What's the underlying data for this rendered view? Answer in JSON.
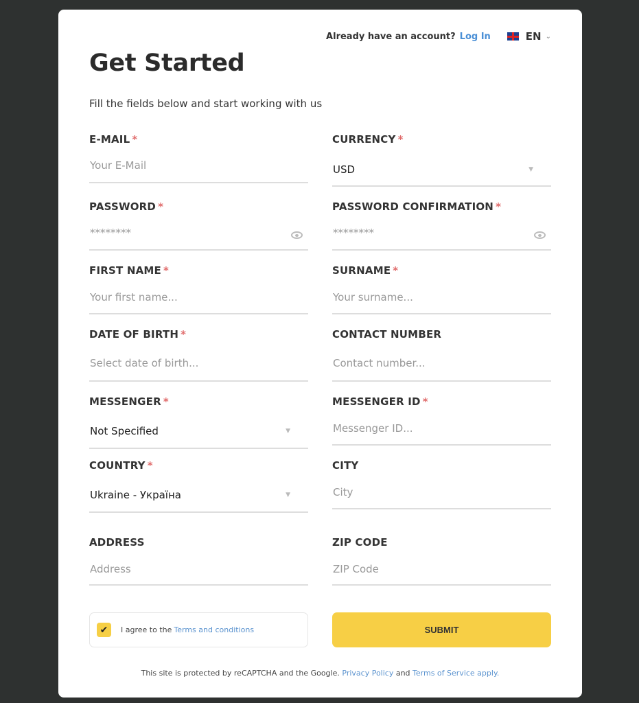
{
  "header": {
    "already": "Already have an account?",
    "login": "Log In",
    "language": "EN",
    "flag_icon": "uk-flag-icon"
  },
  "title": "Get Started",
  "subtitle": "Fill the fields below and start working with us",
  "fields": [
    {
      "label": "E-mail",
      "required": true,
      "placeholder": "Your E-Mail"
    },
    {
      "label": "Currency",
      "required": true,
      "value": "USD"
    },
    {
      "label": "Password",
      "required": true,
      "placeholder": "********"
    },
    {
      "label": "Password Confirmation",
      "required": true,
      "placeholder": "********"
    },
    {
      "label": "First Name",
      "required": true,
      "placeholder": "Your first name..."
    },
    {
      "label": "Surname",
      "required": true,
      "placeholder": "Your surname..."
    },
    {
      "label": "Date of Birth",
      "required": true,
      "placeholder": "Select date of birth..."
    },
    {
      "label": "Contact Number",
      "required": false,
      "placeholder": "Contact number..."
    },
    {
      "label": "Messenger",
      "required": true,
      "value": "Not Specified"
    },
    {
      "label": "Messenger ID",
      "required": true,
      "placeholder": "Messenger ID..."
    },
    {
      "label": "Country",
      "required": true,
      "value": "Ukraine - Україна"
    },
    {
      "label": "City",
      "required": false,
      "placeholder": "City"
    },
    {
      "label": "Address",
      "required": false,
      "placeholder": "Address"
    },
    {
      "label": "ZIP Code",
      "required": false,
      "placeholder": "ZIP Code"
    }
  ],
  "required_mark": "*",
  "agree": {
    "checked": true,
    "text": "I agree to the",
    "link": "Terms and conditions"
  },
  "submit": "SUBMIT",
  "footer": {
    "text": "This site is protected by reCAPTCHA and the Google.",
    "privacy": "Privacy Policy",
    "and": "and",
    "terms": "Terms of Service apply."
  },
  "colors": {
    "accent": "#f7cf45",
    "link": "#4a8fd6",
    "required": "#e06b6b",
    "background": "#2e3130"
  }
}
